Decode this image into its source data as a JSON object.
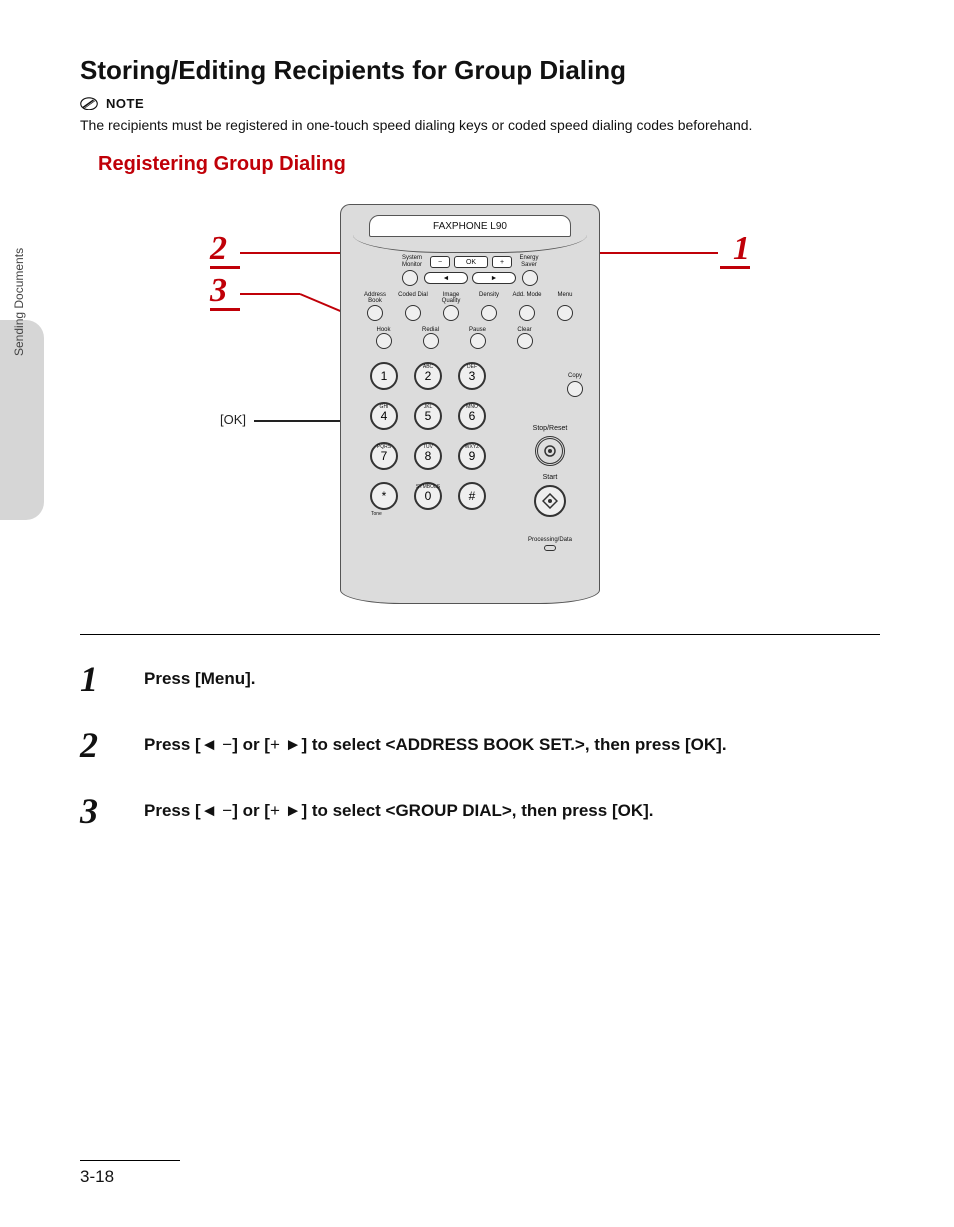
{
  "sidebar": {
    "label": "Sending Documents"
  },
  "section": {
    "title": "Storing/Editing Recipients for Group Dialing",
    "note_label": "NOTE",
    "note_text": "The recipients must be registered in one-touch speed dialing keys or coded speed dialing codes beforehand.",
    "subsection": "Registering Group Dialing"
  },
  "diagram": {
    "device_model": "FAXPHONE L90",
    "ok_label": "[OK]",
    "callouts": {
      "c1": "1",
      "c2": "2",
      "c3": "3"
    },
    "top_row": {
      "system_monitor": "System\nMonitor",
      "ok": "OK",
      "minus": "−",
      "plus": "+",
      "energy_saver": "Energy\nSaver"
    },
    "button_row1": [
      "Address Book",
      "Coded Dial",
      "Image Quality",
      "Density",
      "Add. Mode",
      "Menu"
    ],
    "button_row2": [
      "Hook",
      "Redial",
      "Pause",
      "Clear"
    ],
    "copy_label": "Copy",
    "keypad": {
      "keys": [
        "1",
        "2",
        "3",
        "4",
        "5",
        "6",
        "7",
        "8",
        "9",
        "*",
        "0",
        "#"
      ],
      "letters": [
        "",
        "ABC",
        "DEF",
        "GHI",
        "JKL",
        "MNO",
        "PQRS",
        "TUV",
        "WXYZ",
        "Tone",
        "SYMBOLS",
        ""
      ]
    },
    "right": {
      "stop_reset": "Stop/Reset",
      "start": "Start",
      "processing": "Processing/Data"
    }
  },
  "steps": [
    {
      "num": "1",
      "text": "Press [Menu]."
    },
    {
      "num": "2",
      "text_pre": "Press [",
      "arrow1": "◄ −",
      "text_mid": "] or [",
      "arrow2": "+ ►",
      "text_post": "] to select <ADDRESS BOOK SET.>, then press [OK]."
    },
    {
      "num": "3",
      "text_pre": "Press [",
      "arrow1": "◄ −",
      "text_mid": "] or [",
      "arrow2": "+ ►",
      "text_post": "] to select <GROUP DIAL>, then press [OK]."
    }
  ],
  "footer": {
    "page": "3-18"
  }
}
